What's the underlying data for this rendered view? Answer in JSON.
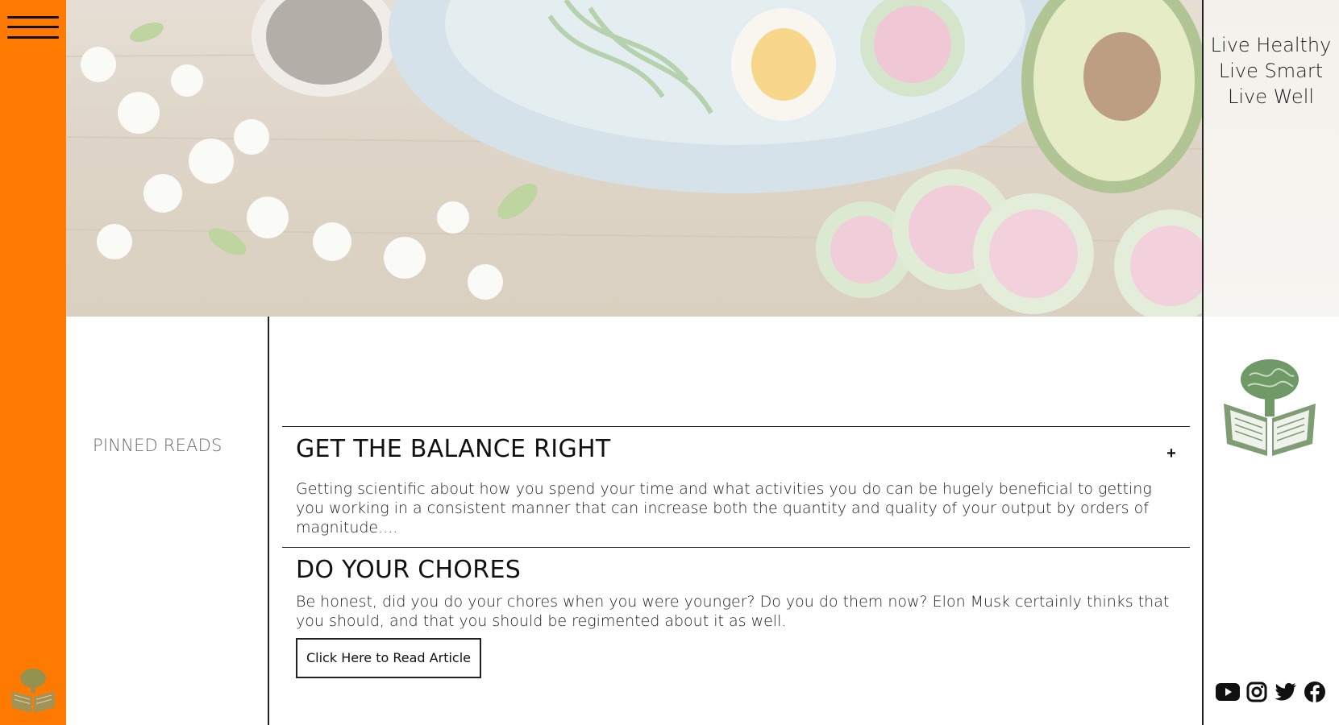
{
  "nav": {
    "menu_icon": "hamburger-menu-icon"
  },
  "tagline": {
    "lines": [
      "Live Healthy",
      "Live Smart",
      "Live Well"
    ]
  },
  "sidebar": {
    "pinned_label": "PINNED READS"
  },
  "articles": [
    {
      "title": "GET THE BALANCE RIGHT",
      "excerpt": "Getting scientific about how you spend your time and what activities you do can be hugely beneficial to getting you working in a consistent manner that can increase both the quantity and quality of your output by orders of magnitude....",
      "toggle_symbol": "+"
    },
    {
      "title": "DO YOUR CHORES",
      "excerpt": "Be honest, did you do your chores when you were younger? Do you do them now? Elon Musk certainly thinks that you should, and that you should be regimented about it as well.",
      "button_label": "Click Here to Read Article"
    }
  ],
  "social": {
    "icons": [
      "youtube-icon",
      "instagram-icon",
      "twitter-icon",
      "facebook-icon"
    ]
  },
  "colors": {
    "accent": "#ff7a00",
    "logo_green": "#7a9a6a"
  }
}
